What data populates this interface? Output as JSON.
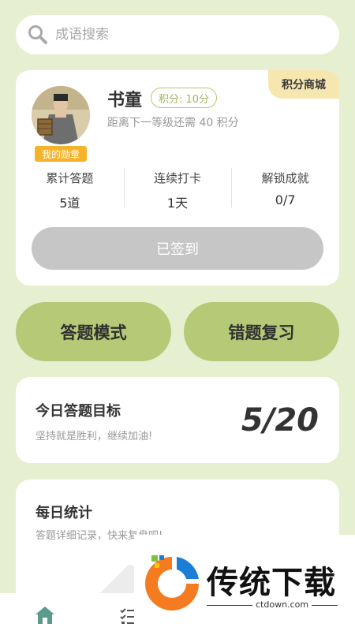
{
  "search": {
    "placeholder": "成语搜索",
    "icon": "search-icon"
  },
  "profile": {
    "shop_label": "积分商城",
    "medal_label": "我的勋章",
    "name": "书童",
    "points_label": "积分: 10分",
    "level_note": "距离下一等级还需 40 积分",
    "stats": [
      {
        "label": "累计答题",
        "value": "5道"
      },
      {
        "label": "连续打卡",
        "value": "1天"
      },
      {
        "label": "解锁成就",
        "value": "0/7"
      }
    ],
    "signin_label": "已签到"
  },
  "modes": {
    "quiz": "答题模式",
    "review": "错题复习"
  },
  "goal": {
    "title": "今日答题目标",
    "subtitle": "坚持就是胜利，继续加油!",
    "value": "5/20"
  },
  "daily": {
    "title": "每日统计",
    "subtitle": "答题详细记录，快来复盘吧!"
  },
  "watermark": {
    "brand": "传统下载",
    "url": "ctdown.com"
  },
  "tabbar": {
    "active_color": "#5a9b8c"
  },
  "colors": {
    "accent": "#b5c977",
    "background": "#e6efd0",
    "medal": "#f5b32a"
  }
}
